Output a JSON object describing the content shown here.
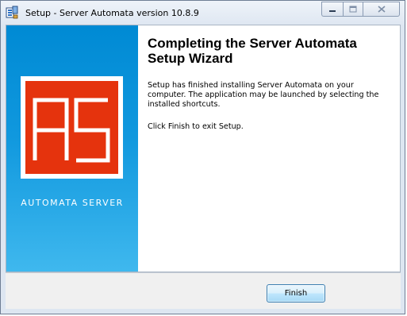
{
  "window": {
    "title": "Setup - Server Automata version 10.8.9"
  },
  "controls": {
    "minimize": "minimize-icon",
    "maximize": "maximize-icon",
    "close": "close-icon"
  },
  "sidebar": {
    "logo_letters": "AS",
    "logo_colors": {
      "frame": "#ffffff",
      "tile": "#e5330d"
    },
    "caption": "AUTOMATA SERVER",
    "gradient": [
      "#008ad4",
      "#3fb8ee"
    ]
  },
  "main": {
    "heading": "Completing the Server Automata Setup Wizard",
    "paragraph1": "Setup has finished installing Server Automata on your computer. The application may be launched by selecting the installed shortcuts.",
    "paragraph2": "Click Finish to exit Setup."
  },
  "footer": {
    "finish_label": "Finish"
  }
}
